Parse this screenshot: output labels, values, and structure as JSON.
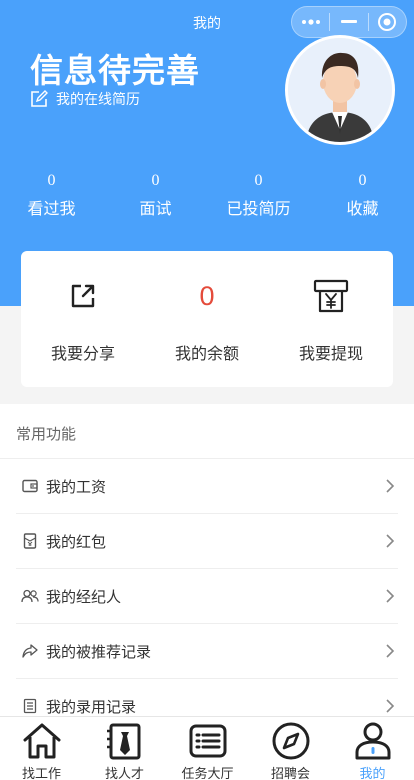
{
  "nav": {
    "title": "我的"
  },
  "profile": {
    "title": "信息待完善",
    "resume_link": "我的在线简历"
  },
  "stats": [
    {
      "value": "0",
      "label": "看过我"
    },
    {
      "value": "0",
      "label": "面试"
    },
    {
      "value": "0",
      "label": "已投简历"
    },
    {
      "value": "0",
      "label": "收藏"
    }
  ],
  "wallet": {
    "share_label": "我要分享",
    "balance_value": "0",
    "balance_label": "我的余额",
    "withdraw_label": "我要提现"
  },
  "functions": {
    "section_title": "常用功能",
    "items": [
      {
        "label": "我的工资",
        "icon": "wallet-icon"
      },
      {
        "label": "我的红包",
        "icon": "red-packet-icon"
      },
      {
        "label": "我的经纪人",
        "icon": "agents-icon"
      },
      {
        "label": "我的被推荐记录",
        "icon": "share-arrow-icon"
      },
      {
        "label": "我的录用记录",
        "icon": "list-icon"
      }
    ]
  },
  "tabbar": {
    "items": [
      {
        "label": "找工作",
        "icon": "home-icon"
      },
      {
        "label": "找人才",
        "icon": "talent-icon"
      },
      {
        "label": "任务大厅",
        "icon": "task-list-icon"
      },
      {
        "label": "招聘会",
        "icon": "compass-icon"
      },
      {
        "label": "我的",
        "icon": "person-icon"
      }
    ],
    "active_index": 4
  },
  "colors": {
    "primary": "#4aa1fb",
    "balance": "#e44b3b",
    "background": "#f4f4f4"
  }
}
